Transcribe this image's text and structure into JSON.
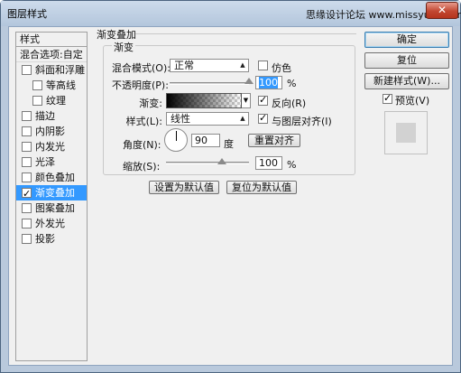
{
  "window": {
    "title": "图层样式",
    "watermark": "思缘设计论坛 www.missyuan.com",
    "close_glyph": "✕"
  },
  "style_list": {
    "header": "样式",
    "blending_options": "混合选项:自定",
    "items": [
      {
        "label": "斜面和浮雕",
        "checked": false
      },
      {
        "label": "等高线",
        "checked": false,
        "indent": true
      },
      {
        "label": "纹理",
        "checked": false,
        "indent": true
      },
      {
        "label": "描边",
        "checked": false
      },
      {
        "label": "内阴影",
        "checked": false
      },
      {
        "label": "内发光",
        "checked": false
      },
      {
        "label": "光泽",
        "checked": false
      },
      {
        "label": "颜色叠加",
        "checked": false
      },
      {
        "label": "渐变叠加",
        "checked": true,
        "selected": true
      },
      {
        "label": "图案叠加",
        "checked": false
      },
      {
        "label": "外发光",
        "checked": false
      },
      {
        "label": "投影",
        "checked": false
      }
    ]
  },
  "panel": {
    "group_title": "渐变叠加",
    "section_title": "渐变",
    "blend_mode_label": "混合模式(O):",
    "blend_mode_value": "正常",
    "dither_label": "仿色",
    "opacity_label": "不透明度(P):",
    "opacity_value": "100",
    "opacity_fraction": 1.0,
    "percent": "%",
    "gradient_label": "渐变:",
    "reverse_label": "反向(R)",
    "reverse_checked": true,
    "style_label": "样式(L):",
    "style_value": "线性",
    "align_label": "与图层对齐(I)",
    "align_checked": true,
    "angle_label": "角度(N):",
    "angle_value": "90",
    "degree_unit": "度",
    "reset_align_button": "重置对齐",
    "scale_label": "缩放(S):",
    "scale_value": "100",
    "scale_fraction": 0.67,
    "make_default_button": "设置为默认值",
    "reset_default_button": "复位为默认值"
  },
  "buttons": {
    "ok": "确定",
    "reset": "复位",
    "new_style": "新建样式(W)...",
    "preview_label": "预览(V)",
    "preview_checked": true
  }
}
